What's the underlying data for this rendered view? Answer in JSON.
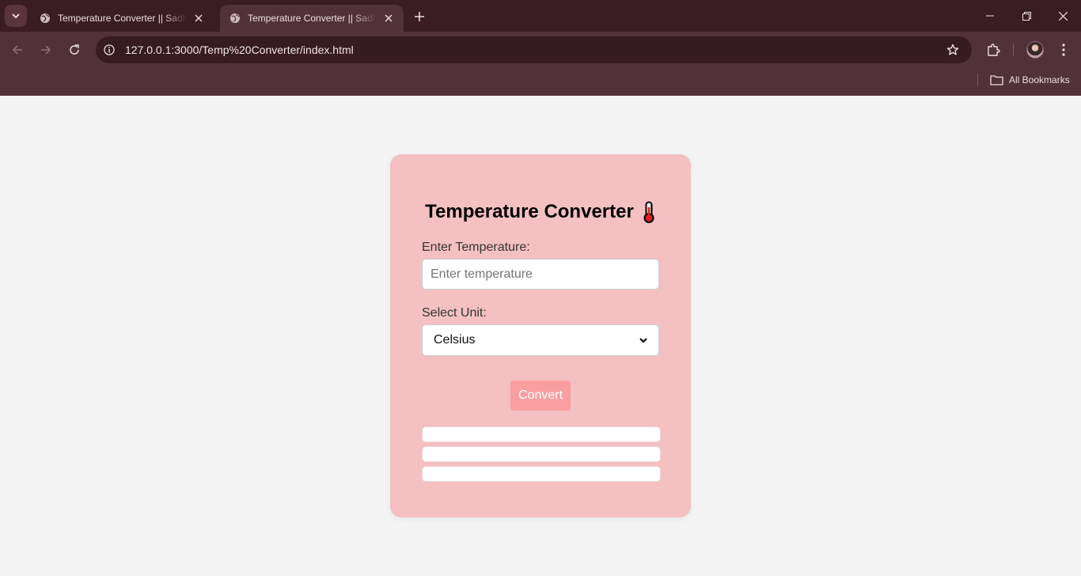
{
  "browser": {
    "tabs": [
      {
        "title": "Temperature Converter || Sadhana",
        "active": false
      },
      {
        "title": "Temperature Converter || Sadhana",
        "active": true
      }
    ],
    "url": "127.0.0.1:3000/Temp%20Converter/index.html",
    "bookmarks_label": "All Bookmarks",
    "icons": [
      "tab-search-icon",
      "globe-icon",
      "close-icon",
      "plus-icon",
      "minimize-icon",
      "restore-icon",
      "window-close-icon",
      "back-icon",
      "forward-icon",
      "reload-icon",
      "site-info-icon",
      "star-icon",
      "extensions-icon",
      "kebab-menu-icon",
      "folder-icon"
    ]
  },
  "app": {
    "title": "Temperature Converter",
    "title_icon": "thermometer-icon",
    "temperature_label": "Enter Temperature:",
    "temperature_value": "",
    "temperature_placeholder": "Enter temperature",
    "unit_label": "Select Unit:",
    "unit_selected": "Celsius",
    "convert_label": "Convert",
    "results": [
      "",
      "",
      ""
    ]
  },
  "colors": {
    "card_bg": "#f4c0c1",
    "button_bg": "#f99fa1",
    "page_bg": "#f4f4f4",
    "chrome_bg": "#51313a"
  }
}
